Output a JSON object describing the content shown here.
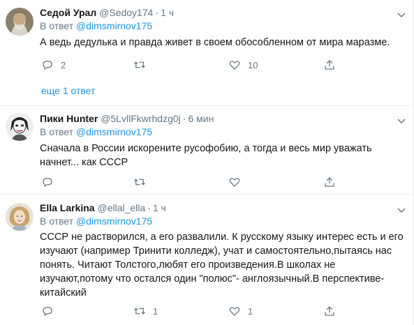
{
  "tweets": [
    {
      "name": "Седой Урал",
      "handle": "@Sedoy174",
      "time": "1 ч",
      "reply_prefix": "В ответ",
      "reply_to": "@dimsmirnov175",
      "text": "А ведь дедулька и правда живет в своем обособленном от мира маразме.",
      "replies": "2",
      "retweets": "",
      "likes": "10"
    },
    {
      "name": "Пики Hunter",
      "handle": "@5LvllFkwrhdzg0j",
      "time": "6 мин",
      "reply_prefix": "В ответ",
      "reply_to": "@dimsmirnov175",
      "text": "Сначала в России искорените русофобию, а тогда и весь мир уважать начнет... как СССР",
      "replies": "",
      "retweets": "",
      "likes": ""
    },
    {
      "name": "Ella Larkina",
      "handle": "@ellal_ella",
      "time": "1 ч",
      "reply_prefix": "В ответ",
      "reply_to": "@dimsmirnov175",
      "text": "СССР не растворился, а его развалили. К русскому языку интерес есть и его изучают (например Тринити колледж), учат и самостоятельно,пытаясь нас понять. Читают Толстого,любят его произведения.В школах не изучают,потому что остался один \"полюс\"- англоязычный.В перспективе-китайский",
      "replies": "",
      "retweets": "1",
      "likes": "1"
    }
  ],
  "show_more": "еще 1 ответ",
  "colors": {
    "link": "#1b95e0",
    "muted": "#657786",
    "text": "#14171a",
    "divider": "#e6ecf0"
  }
}
